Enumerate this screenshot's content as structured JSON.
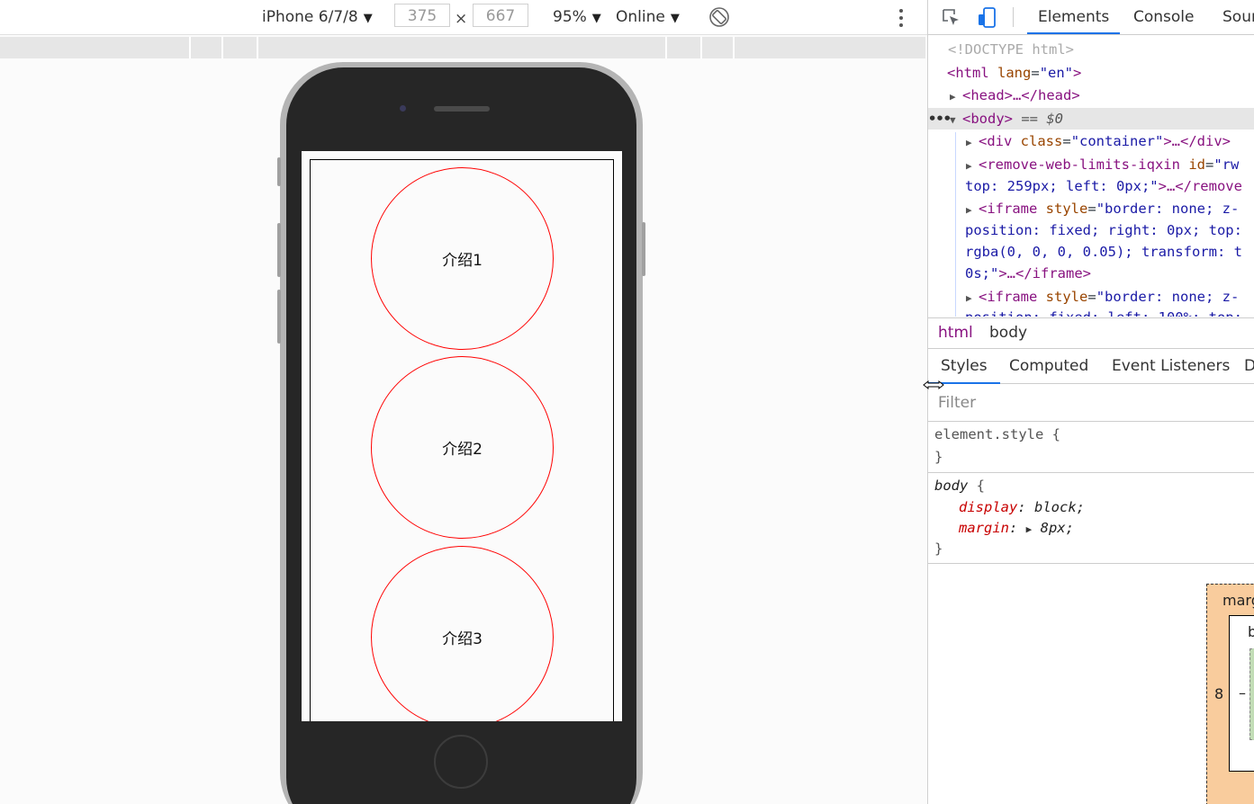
{
  "device_toolbar": {
    "device": "iPhone 6/7/8",
    "width": "375",
    "times": "×",
    "height": "667",
    "zoom": "95%",
    "network": "Online"
  },
  "page": {
    "circles": [
      {
        "label": "介绍1"
      },
      {
        "label": "介绍2"
      },
      {
        "label": "介绍3"
      }
    ]
  },
  "devtools": {
    "tabs": [
      "Elements",
      "Console",
      "Sour"
    ],
    "active_tab": "Elements",
    "dom": {
      "doctype": "<!DOCTYPE html>",
      "html_tag": "<html",
      "html_attr": "lang",
      "html_attr_val": "\"en\"",
      "html_close": ">",
      "head": "<head>…</head>",
      "body_open": "<body>",
      "body_marker": " == $0",
      "div_open": "<div",
      "div_attr": "class",
      "div_val": "\"container\"",
      "div_close": ">…</div>",
      "rwl_open": "<remove-web-limits-iqxin",
      "rwl_attr": "id",
      "rwl_val": "\"rw",
      "rwl_line2": "top: 259px; left: 0px;\"",
      "rwl_close": ">…</remove",
      "iframe1_open": "<iframe",
      "iframe1_attr": "style",
      "iframe1_val": "\"border: none; z-",
      "iframe1_line2": "position: fixed; right: 0px; top:",
      "iframe1_line3": "rgba(0, 0, 0, 0.05); transform: t",
      "iframe1_line4": "0s;\"",
      "iframe1_close": ">…</iframe>",
      "iframe2_open": "<iframe",
      "iframe2_attr": "style",
      "iframe2_val": "\"border: none; z-",
      "iframe2_line2": "position: fixed; left: 100%; top:"
    },
    "breadcrumbs": [
      "html",
      "body"
    ],
    "style_tabs": [
      "Styles",
      "Computed",
      "Event Listeners",
      "D"
    ],
    "filter_placeholder": "Filter",
    "rules": {
      "element_style": "element.style {",
      "element_close": "}",
      "body_selector": "body",
      "body_open_brace": "{",
      "display_prop": "display",
      "display_val": "block;",
      "margin_prop": "margin",
      "margin_val": "8px;",
      "body_close": "}"
    },
    "box_model": {
      "margin_label": "marg",
      "border_label": "b",
      "margin_left": "8",
      "dash": "–"
    }
  }
}
